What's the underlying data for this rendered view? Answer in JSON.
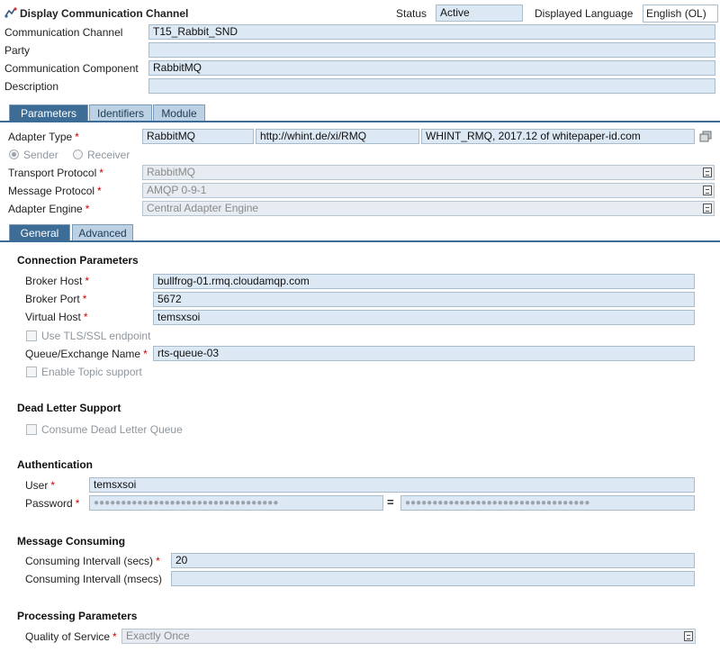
{
  "header": {
    "title": "Display Communication Channel",
    "status_label": "Status",
    "status_value": "Active",
    "language_label": "Displayed Language",
    "language_value": "English (OL)"
  },
  "channel": {
    "communication_channel_label": "Communication Channel",
    "communication_channel_value": "T15_Rabbit_SND",
    "party_label": "Party",
    "party_value": "",
    "component_label": "Communication Component",
    "component_value": "RabbitMQ",
    "description_label": "Description",
    "description_value": ""
  },
  "main_tabs": [
    "Parameters",
    "Identifiers",
    "Module"
  ],
  "adapter": {
    "type_label": "Adapter Type",
    "type_value": "RabbitMQ",
    "namespace_value": "http://whint.de/xi/RMQ",
    "swc_value": "WHINT_RMQ, 2017.12 of whitepaper-id.com",
    "sender_label": "Sender",
    "receiver_label": "Receiver",
    "transport_label": "Transport Protocol",
    "transport_value": "RabbitMQ",
    "message_label": "Message Protocol",
    "message_value": "AMQP 0-9-1",
    "engine_label": "Adapter Engine",
    "engine_value": "Central Adapter Engine"
  },
  "sub_tabs": [
    "General",
    "Advanced"
  ],
  "connection": {
    "title": "Connection Parameters",
    "host_label": "Broker Host",
    "host_value": "bullfrog-01.rmq.cloudamqp.com",
    "port_label": "Broker Port",
    "port_value": "5672",
    "vhost_label": "Virtual Host",
    "vhost_value": "temsxsoi",
    "tls_label": "Use TLS/SSL endpoint",
    "queue_label": "Queue/Exchange Name",
    "queue_value": "rts-queue-03",
    "topic_label": "Enable Topic support"
  },
  "dead_letter": {
    "title": "Dead Letter Support",
    "consume_label": "Consume Dead Letter Queue"
  },
  "auth": {
    "title": "Authentication",
    "user_label": "User",
    "user_value": "temsxsoi",
    "password_label": "Password",
    "password_value": "●●●●●●●●●●●●●●●●●●●●●●●●●●●●●●●●●●",
    "password_confirm": "●●●●●●●●●●●●●●●●●●●●●●●●●●●●●●●●●●",
    "equals": "="
  },
  "consuming": {
    "title": "Message Consuming",
    "secs_label": "Consuming Intervall (secs)",
    "secs_value": "20",
    "msecs_label": "Consuming Intervall (msecs)",
    "msecs_value": ""
  },
  "processing": {
    "title": "Processing Parameters",
    "qos_label": "Quality of Service",
    "qos_value": "Exactly Once"
  },
  "required_mark": "*"
}
